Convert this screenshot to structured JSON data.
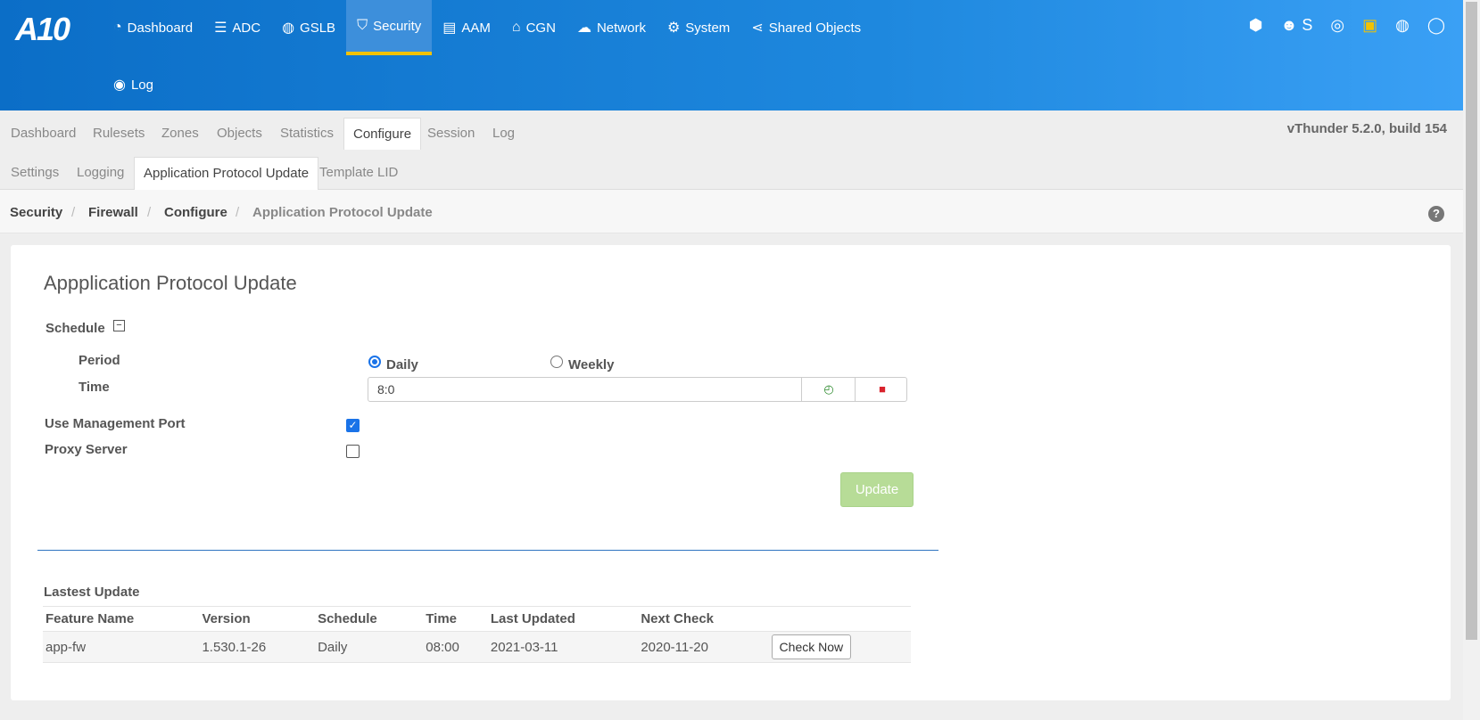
{
  "logo": "A10",
  "nav": [
    {
      "label": "Dashboard",
      "icon": "dashboard-icon",
      "glyph": "◔"
    },
    {
      "label": "ADC",
      "icon": "server-icon",
      "glyph": "☰"
    },
    {
      "label": "GSLB",
      "icon": "globe-icon",
      "glyph": "◍"
    },
    {
      "label": "Security",
      "icon": "shield-icon",
      "glyph": "⛉"
    },
    {
      "label": "AAM",
      "icon": "id-card-icon",
      "glyph": "▤"
    },
    {
      "label": "CGN",
      "icon": "inbox-icon",
      "glyph": "⌂"
    },
    {
      "label": "Network",
      "icon": "cloud-icon",
      "glyph": "☁"
    },
    {
      "label": "System",
      "icon": "gear-icon",
      "glyph": "⚙"
    },
    {
      "label": "Shared Objects",
      "icon": "share-icon",
      "glyph": "⋖"
    }
  ],
  "nav2": {
    "label": "Log",
    "icon": "eye-icon",
    "glyph": "◉"
  },
  "right_icons": {
    "cubes": "⬢",
    "users": "☻ S",
    "support": "◎",
    "save": "▣",
    "globe": "◍",
    "user": "◯"
  },
  "tabs1": [
    "Dashboard",
    "Rulesets",
    "Zones",
    "Objects",
    "Statistics",
    "Configure",
    "Session",
    "Log"
  ],
  "version": "vThunder 5.2.0, build 154",
  "tabs2": [
    "Settings",
    "Logging",
    "Application Protocol Update",
    "Template LID"
  ],
  "breadcrumb": [
    "Security",
    "Firewall",
    "Configure",
    "Application Protocol Update"
  ],
  "form": {
    "title": "Appplication Protocol Update",
    "schedule_label": "Schedule",
    "period_label": "Period",
    "period_options": [
      "Daily",
      "Weekly"
    ],
    "period_selected": "Daily",
    "time_label": "Time",
    "time_value": "8:0",
    "use_mgmt_label": "Use Management Port",
    "use_mgmt_checked": true,
    "proxy_label": "Proxy Server",
    "proxy_checked": false,
    "update_label": "Update"
  },
  "latest": {
    "title": "Lastest Update",
    "columns": [
      "Feature Name",
      "Version",
      "Schedule",
      "Time",
      "Last Updated",
      "Next Check"
    ],
    "rows": [
      [
        "app-fw",
        "1.530.1-26",
        "Daily",
        "08:00",
        "2021-03-11",
        "2020-11-20"
      ]
    ],
    "action_label": "Check Now"
  }
}
